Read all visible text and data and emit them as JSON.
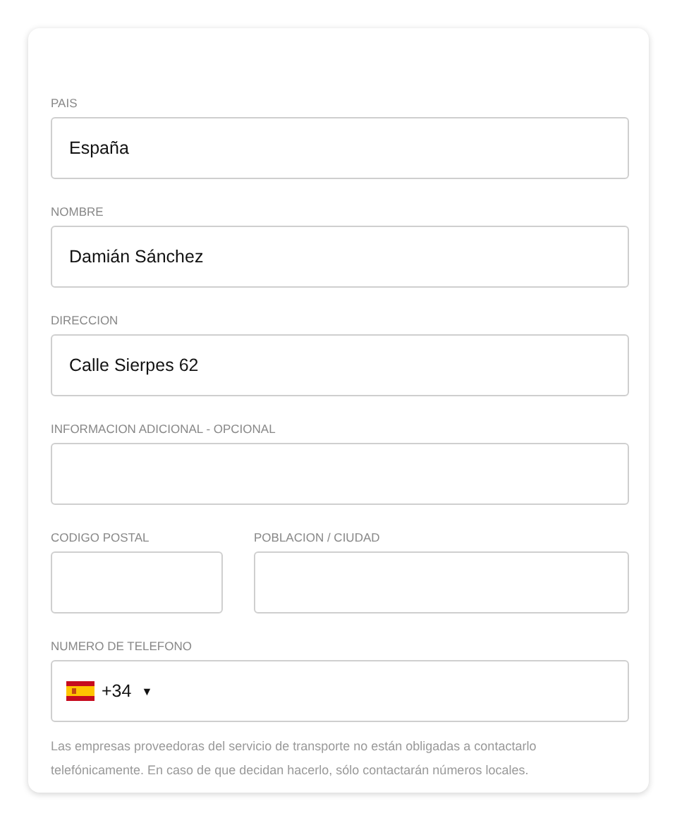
{
  "rows": [
    {
      "fields": [
        {
          "kind": "text",
          "label": "PAIS",
          "value": "España"
        }
      ]
    },
    {
      "fields": [
        {
          "kind": "text",
          "label": "NOMBRE",
          "value": "Damián Sánchez"
        }
      ]
    },
    {
      "fields": [
        {
          "kind": "text",
          "label": "DIRECCION",
          "value": "Calle Sierpes 62"
        }
      ]
    },
    {
      "fields": [
        {
          "kind": "text",
          "label": "INFORMACION ADICIONAL - OPCIONAL"
        }
      ]
    },
    {
      "fields": [
        {
          "kind": "text",
          "label": "CODIGO POSTAL"
        },
        {
          "kind": "text",
          "label": "POBLACION / CIUDAD"
        }
      ]
    },
    {
      "fields": [
        {
          "kind": "phone",
          "label": "NUMERO DE TELEFONO",
          "dial_code": "+34",
          "caret": "▼"
        }
      ]
    }
  ],
  "note": "Las empresas proveedoras del servicio de transporte no están obligadas a contactarlo telefónicamente. En caso de que decidan hacerlo, sólo contactarán números locales."
}
